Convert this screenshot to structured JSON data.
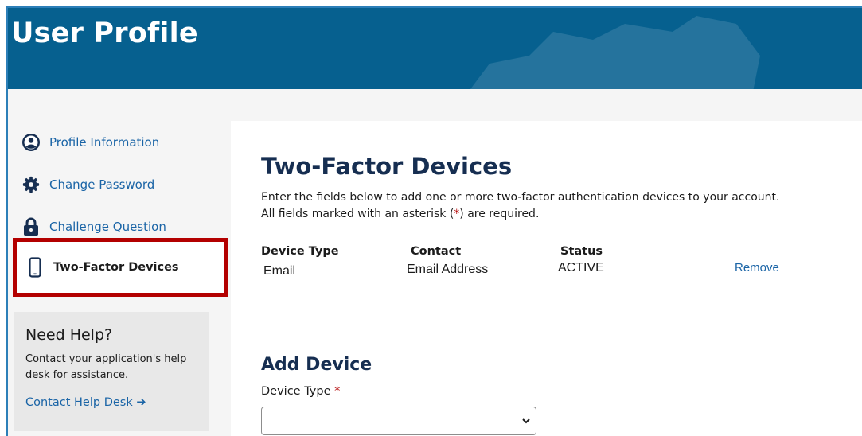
{
  "header": {
    "title": "User Profile"
  },
  "sidebar": {
    "items": [
      {
        "label": "Profile Information",
        "icon": "user-circle-icon"
      },
      {
        "label": "Change Password",
        "icon": "gear-icon"
      },
      {
        "label": "Challenge Question",
        "icon": "lock-icon"
      },
      {
        "label": "Two-Factor Devices",
        "icon": "mobile-phone-icon",
        "active": true
      }
    ],
    "help": {
      "title": "Need Help?",
      "text": "Contact your application's help desk for assistance.",
      "link": "Contact Help Desk ➔"
    }
  },
  "main": {
    "title": "Two-Factor Devices",
    "intro_line1": "Enter the fields below to add one or more two-factor authentication devices to your account.",
    "intro_line2_pre": "All fields marked with an asterisk (",
    "intro_line2_star": "*",
    "intro_line2_post": ") are required.",
    "table": {
      "headers": [
        "Device Type",
        "Contact",
        "Status"
      ],
      "rows": [
        {
          "device_type": "Email",
          "contact": "Email Address",
          "status": "ACTIVE",
          "action": "Remove"
        }
      ]
    },
    "add_device": {
      "title": "Add Device",
      "field_label": "Device Type",
      "required_mark": "*",
      "select_value": ""
    }
  },
  "colors": {
    "banner": "#06608f",
    "link": "#1a64a6",
    "heading": "#162e51",
    "highlight": "#b30000",
    "required": "#b50909"
  }
}
